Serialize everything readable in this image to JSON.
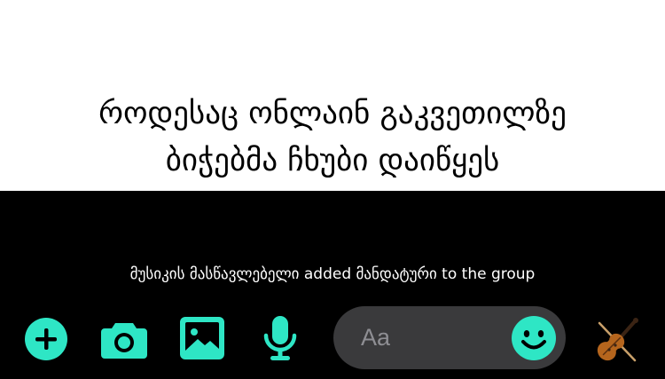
{
  "caption": {
    "line1": "როდესაც ონლაინ გაკვეთილზე",
    "line2": "ბიჭებმა ჩხუბი დაიწყეს"
  },
  "chat": {
    "system_message": "მუსიკის მასწავლებელი added მანდატური to the group"
  },
  "composer": {
    "input_placeholder": "Aa",
    "icons": [
      "plus-icon",
      "camera-icon",
      "image-icon",
      "microphone-icon",
      "emoji-icon",
      "violin-icon"
    ],
    "accent_color": "#2ee6c5"
  }
}
